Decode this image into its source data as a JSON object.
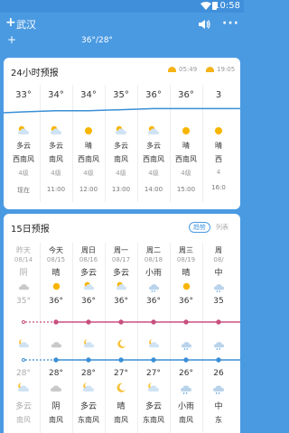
{
  "status": {
    "time": "10:58"
  },
  "header": {
    "add_symbol": "+",
    "city": "武汉",
    "more_symbol": "···"
  },
  "peek": {
    "plus": "+",
    "temp_text": "36°/28°"
  },
  "hourly": {
    "title": "24小时预报",
    "sunrise": "05:49",
    "sunset": "19:05",
    "items": [
      {
        "temp": "33°",
        "icon": "partly-cloudy-icon",
        "cond": "多云",
        "wind": "西南风",
        "level": "4级",
        "time": "现在"
      },
      {
        "temp": "34°",
        "icon": "partly-cloudy-icon",
        "cond": "多云",
        "wind": "南风",
        "level": "4级",
        "time": "11:00"
      },
      {
        "temp": "34°",
        "icon": "sunny-icon",
        "cond": "晴",
        "wind": "西南风",
        "level": "4级",
        "time": "12:00"
      },
      {
        "temp": "35°",
        "icon": "partly-cloudy-icon",
        "cond": "多云",
        "wind": "南风",
        "level": "4级",
        "time": "13:00"
      },
      {
        "temp": "36°",
        "icon": "partly-cloudy-icon",
        "cond": "多云",
        "wind": "西南风",
        "level": "4级",
        "time": "14:00"
      },
      {
        "temp": "36°",
        "icon": "sunny-icon",
        "cond": "晴",
        "wind": "西南风",
        "level": "4级",
        "time": "15:00"
      },
      {
        "temp": "3",
        "icon": "sunny-icon",
        "cond": "晴",
        "wind": "西",
        "level": "4",
        "time": "16:0"
      }
    ]
  },
  "daily": {
    "title": "15日预报",
    "toggle_active": "趋势",
    "toggle_inactive": "列表",
    "items": [
      {
        "week": "昨天",
        "date": "08/14",
        "cond_day": "阴",
        "icon_day": "cloudy-icon",
        "high": "35°",
        "low": "",
        "icon_night": "partly-cloudy-night-icon",
        "low_label": "28°",
        "cond_night": "多云",
        "wind": "南风"
      },
      {
        "week": "今天",
        "date": "08/15",
        "cond_day": "晴",
        "icon_day": "sunny-icon",
        "high": "36°",
        "icon_night": "cloudy-icon",
        "low_label": "28°",
        "cond_night": "阴",
        "wind": "南风"
      },
      {
        "week": "周日",
        "date": "08/16",
        "cond_day": "多云",
        "icon_day": "partly-cloudy-icon",
        "high": "36°",
        "icon_night": "partly-cloudy-night-icon",
        "low_label": "28°",
        "cond_night": "多云",
        "wind": "东南风"
      },
      {
        "week": "周一",
        "date": "08/17",
        "cond_day": "多云",
        "icon_day": "partly-cloudy-icon",
        "high": "36°",
        "icon_night": "moon-icon",
        "low_label": "27°",
        "cond_night": "晴",
        "wind": "南风"
      },
      {
        "week": "周二",
        "date": "08/18",
        "cond_day": "小雨",
        "icon_day": "rain-icon",
        "high": "36°",
        "icon_night": "partly-cloudy-night-icon",
        "low_label": "27°",
        "cond_night": "多云",
        "wind": "东南风"
      },
      {
        "week": "周三",
        "date": "08/19",
        "cond_day": "晴",
        "icon_day": "sunny-icon",
        "high": "36°",
        "icon_night": "rain-icon",
        "low_label": "26°",
        "cond_night": "小雨",
        "wind": "南风"
      },
      {
        "week": "周",
        "date": "08/",
        "cond_day": "中",
        "icon_day": "rain-icon",
        "high": "35",
        "icon_night": "rain-icon",
        "low_label": "26",
        "cond_night": "中",
        "wind": "东"
      }
    ]
  },
  "colors": {
    "brand": "#4a9ae2",
    "hourly_line": "#3a8fd6",
    "high_line": "#c8507e",
    "low_line": "#3a8fd6"
  }
}
